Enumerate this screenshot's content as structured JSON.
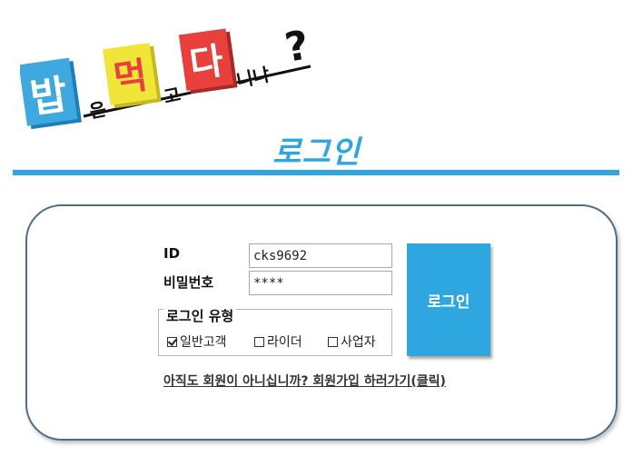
{
  "logo": {
    "text": "밥은 먹고 다니냐?",
    "colors": {
      "blue": "#3fa9df",
      "yellow": "#f2e53a",
      "red": "#e8413d",
      "black": "#111111"
    }
  },
  "title": "로그인",
  "colors": {
    "accent": "#2ea6df",
    "panel_border": "#4f6b84"
  },
  "form": {
    "id_label": "ID",
    "id_value": "cks9692",
    "password_label": "비밀번호",
    "password_value": "****",
    "login_button": "로그인",
    "type_legend": "로그인 유형",
    "types": [
      {
        "label": "일반고객",
        "checked": true
      },
      {
        "label": "라이더",
        "checked": false
      },
      {
        "label": "사업자",
        "checked": false
      }
    ],
    "signup_link": "아직도 회원이 아니십니까? 회원가입 하러가기(클릭)"
  }
}
